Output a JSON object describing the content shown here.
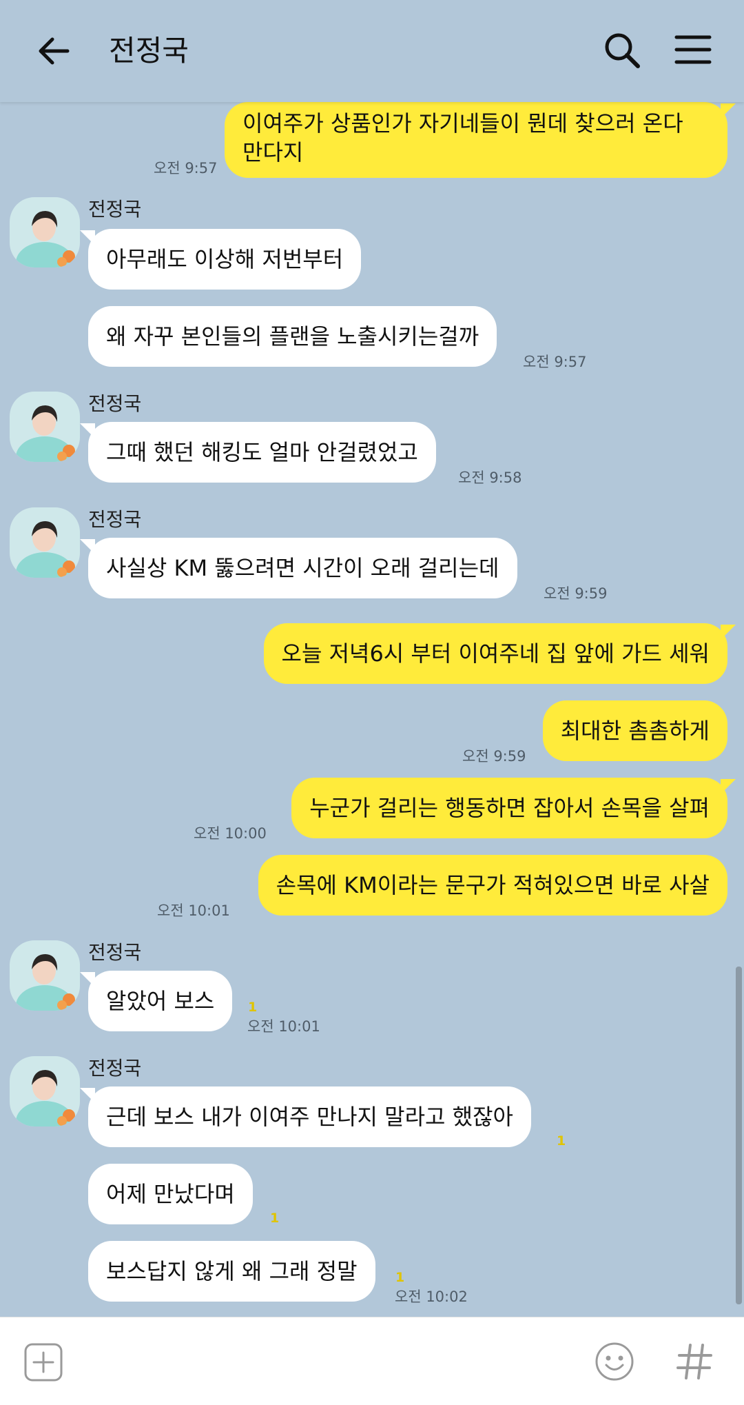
{
  "header": {
    "title": "전정국",
    "back_icon": "arrow-left-icon",
    "search_icon": "search-icon",
    "menu_icon": "hamburger-menu-icon"
  },
  "colors": {
    "background": "#b2c7d9",
    "outgoing_bubble": "#ffeb3b",
    "incoming_bubble": "#ffffff",
    "unread": "#e0c400"
  },
  "messages": [
    {
      "dir": "out",
      "text": "이여주가 상품인가 자기네들이 뭔데 찾으러 온다\n만다지",
      "time": "오전 9:57"
    },
    {
      "dir": "in",
      "sender": "전정국",
      "text": "아무래도 이상해 저번부터"
    },
    {
      "dir": "in",
      "text": "왜 자꾸 본인들의 플랜을 노출시키는걸까",
      "time": "오전 9:57"
    },
    {
      "dir": "in",
      "sender": "전정국",
      "text": "그때 했던 해킹도 얼마 안걸렸었고",
      "time": "오전 9:58"
    },
    {
      "dir": "in",
      "sender": "전정국",
      "text": "사실상 KM 뚫으려면 시간이 오래 걸리는데",
      "time": "오전 9:59"
    },
    {
      "dir": "out",
      "text": "오늘 저녁6시 부터 이여주네 집 앞에 가드 세워"
    },
    {
      "dir": "out",
      "text": "최대한 촘촘하게",
      "time": "오전 9:59"
    },
    {
      "dir": "out",
      "text": "누군가 걸리는 행동하면 잡아서 손목을 살펴",
      "time": "오전 10:00"
    },
    {
      "dir": "out",
      "text": "손목에 KM이라는 문구가 적혀있으면 바로 사살",
      "time": "오전 10:01"
    },
    {
      "dir": "in",
      "sender": "전정국",
      "text": "알았어 보스",
      "unread": "1",
      "time": "오전 10:01"
    },
    {
      "dir": "in",
      "sender": "전정국",
      "text": "근데 보스 내가 이여주 만나지 말라고 했잖아",
      "unread": "1"
    },
    {
      "dir": "in",
      "text": "어제 만났다며",
      "unread": "1"
    },
    {
      "dir": "in",
      "text": "보스답지 않게 왜 그래 정말",
      "unread": "1",
      "time": "오전 10:02"
    }
  ],
  "input": {
    "placeholder": "",
    "add_icon": "plus-square-icon",
    "emoji_icon": "emoticon-icon",
    "hash_icon": "hashtag-icon"
  }
}
